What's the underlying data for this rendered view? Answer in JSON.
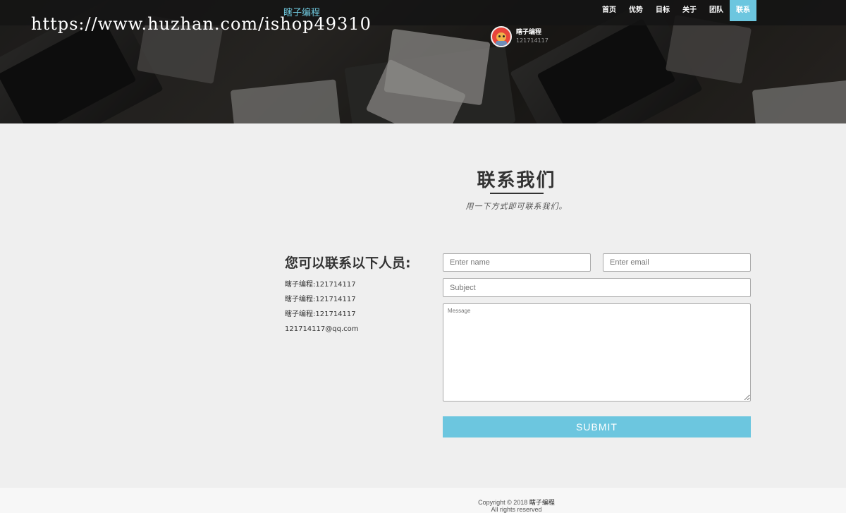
{
  "header": {
    "brand": "瞎子编程",
    "watermark": "https://www.huzhan.com/ishop49310",
    "nav": [
      {
        "label": "首页"
      },
      {
        "label": "优势"
      },
      {
        "label": "目标"
      },
      {
        "label": "关于"
      },
      {
        "label": "团队"
      },
      {
        "label": "联系",
        "active": true
      }
    ],
    "profile": {
      "name": "瞎子编程",
      "id": "121714117"
    }
  },
  "contact": {
    "title": "联系我们",
    "subtitle": "用一下方式即可联系我们。",
    "people_heading": "您可以联系以下人员:",
    "people": [
      "瞎子编程:121714117",
      "瞎子编程:121714117",
      "瞎子编程:121714117",
      "121714117@qq.com"
    ]
  },
  "form": {
    "name_placeholder": "Enter name",
    "email_placeholder": "Enter email",
    "subject_placeholder": "Subject",
    "message_placeholder": "Message",
    "submit_label": "SUBMIT"
  },
  "footer": {
    "copyright_prefix": "Copyright © 2018",
    "copyright_brand": "瞎子编程",
    "rights": "All rights reserved"
  },
  "colors": {
    "accent": "#6cc6df",
    "brand_text": "#6fc9df",
    "page_bg": "#efefef",
    "nav_bg": "#141414"
  }
}
